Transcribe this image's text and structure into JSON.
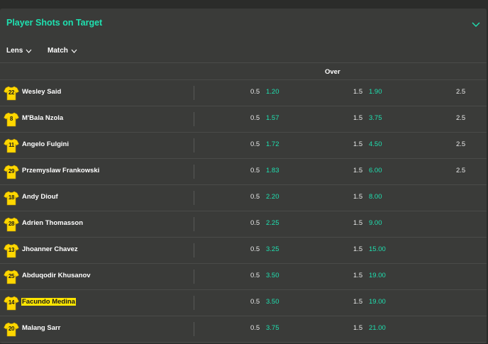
{
  "header": {
    "title": "Player Shots on Target"
  },
  "filters": {
    "lens_label": "Lens",
    "match_label": "Match"
  },
  "columns": {
    "over_label": "Over"
  },
  "colors": {
    "accent": "#1fe0b0",
    "shirt": "#ffd700",
    "highlight": "#ffe600"
  },
  "players": [
    {
      "number": "22",
      "name": "Wesley Said",
      "line1": "0.5",
      "odds1": "1.20",
      "line2": "1.5",
      "odds2": "1.90",
      "line3": "2.5"
    },
    {
      "number": "8",
      "name": "M'Bala Nzola",
      "line1": "0.5",
      "odds1": "1.57",
      "line2": "1.5",
      "odds2": "3.75",
      "line3": "2.5"
    },
    {
      "number": "11",
      "name": "Angelo Fulgini",
      "line1": "0.5",
      "odds1": "1.72",
      "line2": "1.5",
      "odds2": "4.50",
      "line3": "2.5"
    },
    {
      "number": "29",
      "name": "Przemyslaw Frankowski",
      "line1": "0.5",
      "odds1": "1.83",
      "line2": "1.5",
      "odds2": "6.00",
      "line3": "2.5"
    },
    {
      "number": "18",
      "name": "Andy Diouf",
      "line1": "0.5",
      "odds1": "2.20",
      "line2": "1.5",
      "odds2": "8.00",
      "line3": ""
    },
    {
      "number": "28",
      "name": "Adrien Thomasson",
      "line1": "0.5",
      "odds1": "2.25",
      "line2": "1.5",
      "odds2": "9.00",
      "line3": ""
    },
    {
      "number": "13",
      "name": "Jhoanner Chavez",
      "line1": "0.5",
      "odds1": "3.25",
      "line2": "1.5",
      "odds2": "15.00",
      "line3": ""
    },
    {
      "number": "25",
      "name": "Abduqodir Khusanov",
      "line1": "0.5",
      "odds1": "3.50",
      "line2": "1.5",
      "odds2": "19.00",
      "line3": ""
    },
    {
      "number": "14",
      "name": "Facundo Medina",
      "highlighted": true,
      "line1": "0.5",
      "odds1": "3.50",
      "line2": "1.5",
      "odds2": "19.00",
      "line3": ""
    },
    {
      "number": "20",
      "name": "Malang Sarr",
      "line1": "0.5",
      "odds1": "3.75",
      "line2": "1.5",
      "odds2": "21.00",
      "line3": ""
    }
  ]
}
